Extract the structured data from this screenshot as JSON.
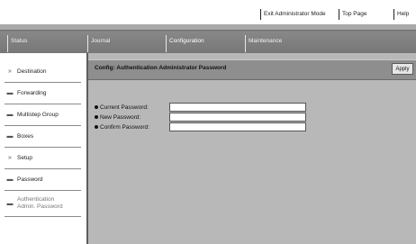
{
  "top_links": [
    "Exit Administrator Mode",
    "Top Page",
    "Help"
  ],
  "nav_tabs": [
    "Status",
    "Journal",
    "Configuration",
    "Maintenance"
  ],
  "sidebar": {
    "items": [
      {
        "label": "Destination",
        "icon": "double-chevron-right-icon"
      },
      {
        "label": "Forwarding",
        "icon": "folder-tab-icon"
      },
      {
        "label": "Multistep Group",
        "icon": "folder-tab-icon"
      },
      {
        "label": "Boxes",
        "icon": "folder-tab-icon"
      },
      {
        "label": "Setup",
        "icon": "double-chevron-right-icon"
      },
      {
        "label": "Password",
        "icon": "folder-tab-icon"
      },
      {
        "label": "Authentication Admin. Password",
        "icon": "folder-tab-icon"
      }
    ]
  },
  "main": {
    "title": "Config: Authentication Administrator Password",
    "apply_label": "Apply",
    "fields": [
      {
        "label": "Current Password:",
        "value": ""
      },
      {
        "label": "New Password:",
        "value": ""
      },
      {
        "label": "Confirm Password:",
        "value": ""
      }
    ]
  }
}
